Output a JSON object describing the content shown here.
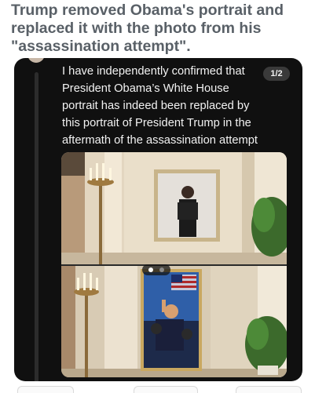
{
  "headline": "Trump removed Obama's portrait and replaced it with the photo from his \"assassination attempt\".",
  "post": {
    "text": "I have independently confirmed that President Obama’s White House portrait has indeed been replaced by this portrait of President Trump in the aftermath of the assassination attempt against him.",
    "page_indicator": "1/2"
  },
  "media": {
    "image_count": 2,
    "active_index": 1
  },
  "colors": {
    "card_background": "#101010",
    "headline_text": "#596067",
    "post_text": "#f2f2f2"
  }
}
